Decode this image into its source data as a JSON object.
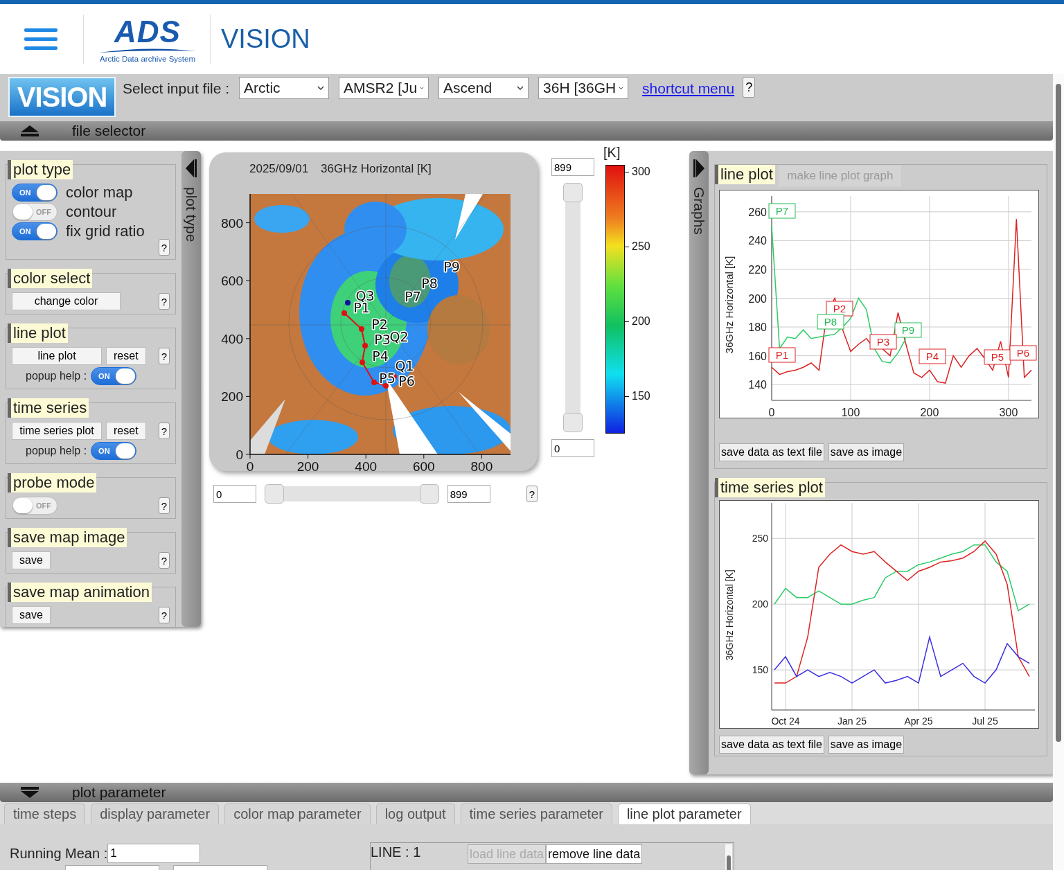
{
  "header": {
    "logo_mark": "ADS",
    "logo_tagline": "Arctic Data archive System",
    "app_title": "VISION"
  },
  "toolbar": {
    "logo_text": "VISION",
    "label": "Select input file :",
    "selects": [
      "Arctic",
      "AMSR2 [Ju",
      "Ascend",
      "36H [36GH"
    ],
    "link": "shortcut menu",
    "help": "?"
  },
  "file_selector": {
    "label": "file selector"
  },
  "left_panel": {
    "tab_label": "plot type",
    "sections": [
      {
        "kind": "toggles",
        "title": "plot type",
        "toggles": [
          {
            "label": "color map",
            "on": true,
            "text": "ON"
          },
          {
            "label": "contour",
            "on": false,
            "text": "OFF"
          },
          {
            "label": "fix grid ratio",
            "on": true,
            "text": "ON"
          }
        ],
        "help": "?"
      },
      {
        "kind": "buttons",
        "title": "color select",
        "buttons": [
          "change color"
        ],
        "help": "?"
      },
      {
        "kind": "buttons",
        "title": "line plot",
        "buttons": [
          "line plot",
          "reset"
        ],
        "popup_help": {
          "label": "popup help :",
          "on": true,
          "text": "ON"
        },
        "help": "?"
      },
      {
        "kind": "buttons",
        "title": "time series",
        "buttons": [
          "time series plot",
          "reset"
        ],
        "popup_help": {
          "label": "popup help :",
          "on": true,
          "text": "ON"
        },
        "help": "?"
      },
      {
        "kind": "toggles",
        "title": "probe mode",
        "toggles": [
          {
            "on": false,
            "text": "OFF"
          }
        ],
        "help": "?"
      },
      {
        "kind": "buttons",
        "title": "save map image",
        "buttons": [
          "save"
        ],
        "help": "?"
      },
      {
        "kind": "buttons",
        "title": "save map animation",
        "buttons": [
          "save"
        ],
        "help": "?"
      }
    ]
  },
  "map": {
    "date": "2025/09/01",
    "title": "36GHz Horizontal [K]",
    "x_ticks": [
      "0",
      "200",
      "400",
      "600",
      "800"
    ],
    "y_ticks": [
      "800",
      "600",
      "400",
      "200",
      "0"
    ],
    "points": [
      "P9",
      "P8",
      "P7",
      "Q3",
      "P1",
      "P2",
      "P3",
      "Q2",
      "P4",
      "Q1",
      "P5",
      "P6"
    ],
    "y_max": "899",
    "y_min": "0",
    "x_min": "0",
    "x_max": "899",
    "help": "?",
    "x_slider": {
      "thumbs": [
        {
          "level": 0
        },
        {
          "level": 1
        }
      ]
    },
    "y_slider": {
      "thumbs": [
        {
          "level": 0
        },
        {
          "level": 1
        }
      ]
    }
  },
  "colorbar": {
    "unit": "[K]",
    "ticks": [
      "300",
      "250",
      "200",
      "150"
    ]
  },
  "right_panel": {
    "tab_label": "Graphs",
    "line_plot": {
      "title": "line plot",
      "make_button": {
        "label": "make line plot graph",
        "disabled": true
      },
      "chart_data": {
        "type": "line",
        "ylabel": "36GHz Horizontal [K]",
        "grid": true,
        "xlim": [
          0,
          329
        ],
        "ylim": [
          129,
          271
        ],
        "xticks": [
          0,
          100,
          200,
          300
        ],
        "yticks": [
          260,
          240,
          220,
          200,
          180,
          160,
          140
        ],
        "x": [
          0,
          10,
          20,
          30,
          40,
          50,
          60,
          70,
          80,
          90,
          100,
          110,
          120,
          130,
          140,
          150,
          160,
          170,
          180,
          190,
          200,
          210,
          220,
          230,
          240,
          250,
          260,
          270,
          280,
          290,
          300,
          310,
          320,
          329
        ],
        "series": [
          {
            "color": "#dd2222",
            "values": [
              152,
              147,
              149,
              150,
              152,
              155,
              150,
              190,
              200,
              178,
              163,
              168,
              172,
              165,
              165,
              160,
              190,
              168,
              148,
              145,
              150,
              142,
              141,
              160,
              152,
              160,
              165,
              158,
              150,
              170,
              145,
              255,
              145,
              150
            ]
          },
          {
            "color": "#2ccc66",
            "values": [
              250,
              165,
              173,
              172,
              178,
              172,
              173,
              174,
              175,
              180,
              186,
              200,
              192,
              165,
              156,
              155,
              162,
              172,
              null,
              null,
              null,
              null,
              null,
              null,
              null,
              null,
              null,
              null,
              null,
              null,
              null,
              null,
              null,
              null
            ]
          }
        ]
      },
      "tags": [
        {
          "label": "P7",
          "color": "#22bb55"
        },
        {
          "label": "P2",
          "color": "#dd2222"
        },
        {
          "label": "P8",
          "color": "#22bb55"
        },
        {
          "label": "P9",
          "color": "#22bb55"
        },
        {
          "label": "P3",
          "color": "#dd2222"
        },
        {
          "label": "P1",
          "color": "#dd2222"
        },
        {
          "label": "P4",
          "color": "#dd2222"
        },
        {
          "label": "P5",
          "color": "#dd2222"
        },
        {
          "label": "P6",
          "color": "#dd2222"
        }
      ],
      "buttons": [
        "save data as text file",
        "save as image"
      ]
    },
    "time_series": {
      "title": "time series plot",
      "chart_data": {
        "type": "line",
        "ylabel": "36GHz Horizontal [K]",
        "grid": true,
        "ylim": [
          119.5,
          277
        ],
        "yticks": [
          250,
          200,
          150
        ],
        "categories": [
          null,
          "Oct 24",
          null,
          null,
          null,
          null,
          null,
          "Jan 25",
          null,
          null,
          null,
          null,
          null,
          "Apr 25",
          null,
          null,
          null,
          null,
          null,
          "Jul 25",
          null,
          null,
          null,
          null
        ],
        "series": [
          {
            "color": "#2ccc66",
            "values": [
              200,
              212,
              205,
              205,
              210,
              205,
              200,
              200,
              203,
              205,
              220,
              225,
              225,
              230,
              232,
              235,
              238,
              240,
              245,
              245,
              232,
              225,
              195,
              200
            ]
          },
          {
            "color": "#dd2222",
            "values": [
              140,
              140,
              145,
              175,
              228,
              238,
              245,
              240,
              238,
              240,
              232,
              225,
              218,
              225,
              228,
              232,
              233,
              235,
              240,
              248,
              238,
              215,
              160,
              145
            ]
          },
          {
            "color": "#3a2ee0",
            "values": [
              150,
              160,
              145,
              150,
              145,
              148,
              145,
              140,
              145,
              150,
              140,
              142,
              145,
              140,
              175,
              145,
              150,
              155,
              145,
              140,
              150,
              170,
              160,
              155
            ]
          }
        ]
      },
      "buttons": [
        "save data as text file",
        "save as image"
      ]
    }
  },
  "plot_parameter": {
    "label": "plot parameter",
    "tabs": [
      {
        "label": "time steps",
        "selected": false
      },
      {
        "label": "display parameter",
        "selected": false
      },
      {
        "label": "color map parameter",
        "selected": false
      },
      {
        "label": "log output",
        "selected": false
      },
      {
        "label": "time series parameter",
        "selected": false
      },
      {
        "label": "line plot parameter",
        "selected": true
      }
    ],
    "running_mean": {
      "label": "Running Mean :",
      "value": "1"
    },
    "line": {
      "label": "LINE : 1",
      "buttons": [
        {
          "label": "load line data",
          "disabled": true
        },
        {
          "label": "remove line data",
          "disabled": false
        }
      ]
    }
  }
}
